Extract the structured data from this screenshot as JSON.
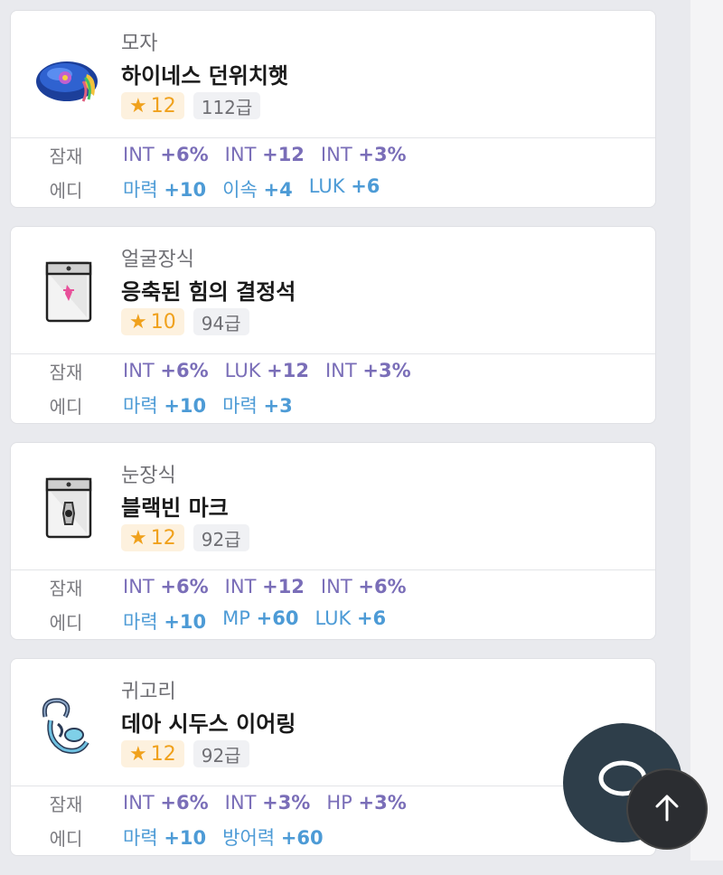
{
  "items": [
    {
      "category": "모자",
      "name": "하이네스 던위치햇",
      "stars": "12",
      "level": "112급",
      "potential_label": "잠재",
      "potential": [
        {
          "stat": "INT",
          "value": "+6%"
        },
        {
          "stat": "INT",
          "value": "+12"
        },
        {
          "stat": "INT",
          "value": "+3%"
        }
      ],
      "additional_label": "에디",
      "additional": [
        {
          "stat": "마력",
          "value": "+10"
        },
        {
          "stat": "이속",
          "value": "+4"
        },
        {
          "stat": "LUK",
          "value": "+6"
        }
      ],
      "icon": "hat-icon"
    },
    {
      "category": "얼굴장식",
      "name": "응축된 힘의 결정석",
      "stars": "10",
      "level": "94급",
      "potential_label": "잠재",
      "potential": [
        {
          "stat": "INT",
          "value": "+6%"
        },
        {
          "stat": "LUK",
          "value": "+12"
        },
        {
          "stat": "INT",
          "value": "+3%"
        }
      ],
      "additional_label": "에디",
      "additional": [
        {
          "stat": "마력",
          "value": "+10"
        },
        {
          "stat": "마력",
          "value": "+3"
        }
      ],
      "icon": "crystal-tag-icon"
    },
    {
      "category": "눈장식",
      "name": "블랙빈 마크",
      "stars": "12",
      "level": "92급",
      "potential_label": "잠재",
      "potential": [
        {
          "stat": "INT",
          "value": "+6%"
        },
        {
          "stat": "INT",
          "value": "+12"
        },
        {
          "stat": "INT",
          "value": "+6%"
        }
      ],
      "additional_label": "에디",
      "additional": [
        {
          "stat": "마력",
          "value": "+10"
        },
        {
          "stat": "MP",
          "value": "+60"
        },
        {
          "stat": "LUK",
          "value": "+6"
        }
      ],
      "icon": "eye-tag-icon"
    },
    {
      "category": "귀고리",
      "name": "데아 시두스 이어링",
      "stars": "12",
      "level": "92급",
      "potential_label": "잠재",
      "potential": [
        {
          "stat": "INT",
          "value": "+6%"
        },
        {
          "stat": "INT",
          "value": "+3%"
        },
        {
          "stat": "HP",
          "value": "+3%"
        }
      ],
      "additional_label": "에디",
      "additional": [
        {
          "stat": "마력",
          "value": "+10"
        },
        {
          "stat": "방어력",
          "value": "+60"
        }
      ],
      "icon": "earring-icon"
    }
  ],
  "colors": {
    "potential": "#7a6eb8",
    "additional": "#4d9bd6",
    "star": "#f0a11c"
  },
  "fab": {
    "chat_icon": "chat-icon",
    "top_icon": "arrow-up-icon"
  }
}
